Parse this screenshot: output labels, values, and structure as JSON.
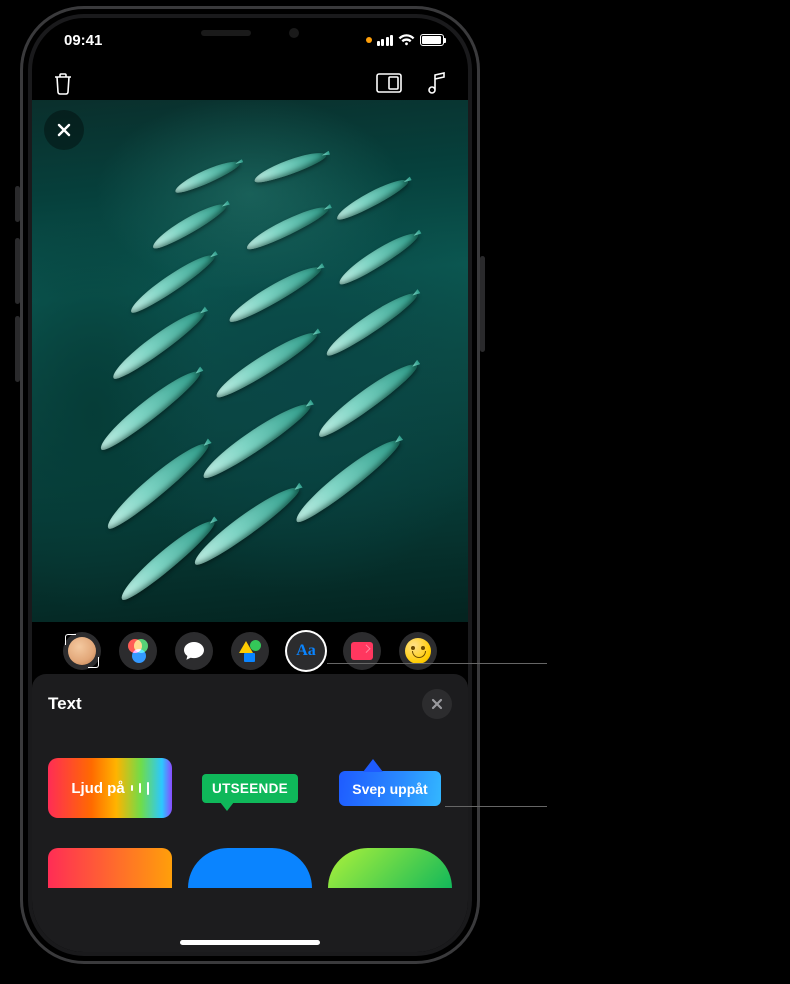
{
  "status": {
    "time": "09:41"
  },
  "panel": {
    "title": "Text",
    "styles": [
      {
        "id": "ljud",
        "label": "Ljud på"
      },
      {
        "id": "utseende",
        "label": "UTSEENDE"
      },
      {
        "id": "svep",
        "label": "Svep uppåt"
      }
    ]
  },
  "effects_toolbar": {
    "items": [
      {
        "id": "memoji",
        "name": "memoji-button"
      },
      {
        "id": "filters",
        "name": "filters-button"
      },
      {
        "id": "messages",
        "name": "messages-button"
      },
      {
        "id": "shapes",
        "name": "shapes-button"
      },
      {
        "id": "text",
        "name": "text-button",
        "active": true,
        "glyph": "Aa"
      },
      {
        "id": "labels",
        "name": "labels-button"
      },
      {
        "id": "emoji",
        "name": "emoji-button"
      }
    ]
  },
  "colors": {
    "accent_blue": "#0a84ff",
    "accent_green": "#0fb85a",
    "accent_pink": "#ff375f"
  }
}
